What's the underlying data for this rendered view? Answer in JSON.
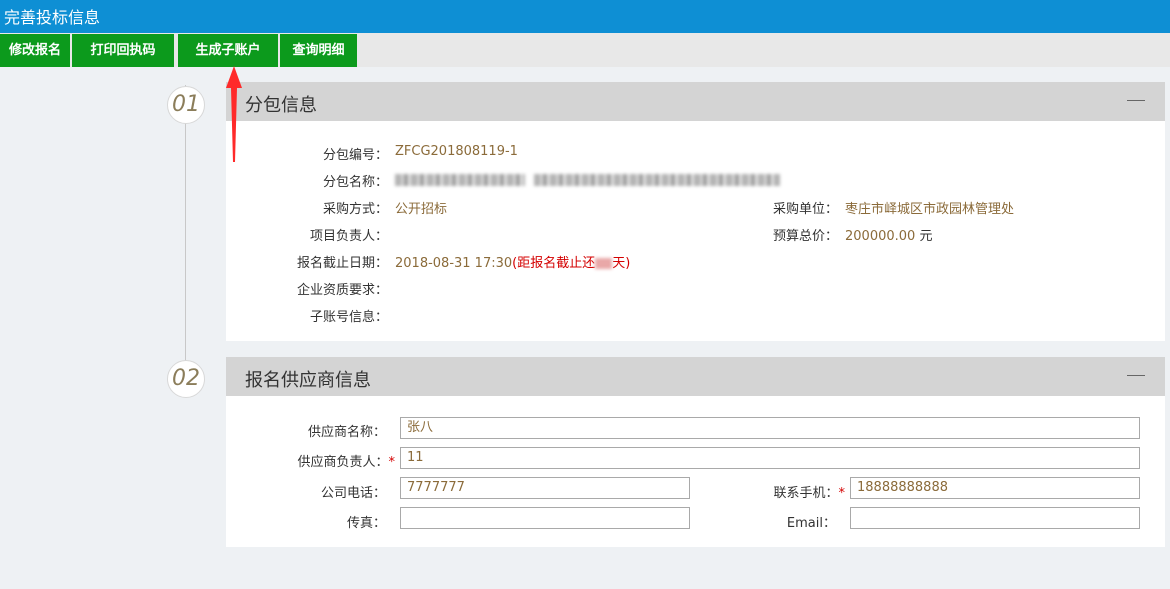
{
  "window": {
    "title": "完善投标信息"
  },
  "toolbar": {
    "modify": "修改报名",
    "print_receipt": "打印回执码",
    "generate_subaccount": "生成子账户",
    "query_details": "查询明细"
  },
  "steps": {
    "step1": "01",
    "step2": "02"
  },
  "package_info": {
    "heading": "分包信息",
    "collapse": "—",
    "number_label": "分包编号：",
    "number_value": "ZFCG201808119-1",
    "name_label": "分包名称：",
    "method_label": "采购方式：",
    "method_value": "公开招标",
    "manager_label": "项目负责人：",
    "deadline_label": "报名截止日期：",
    "deadline_value": "2018-08-31 17:30",
    "deadline_remaining_prefix": "(距报名截止还",
    "deadline_remaining_suffix": "天)",
    "qualification_label": "企业资质要求：",
    "subaccount_label": "子账号信息：",
    "buyer_label": "采购单位：",
    "buyer_value": "枣庄市峄城区市政园林管理处",
    "budget_label": "预算总价：",
    "budget_value": "200000.00",
    "budget_unit": "元"
  },
  "supplier_info": {
    "heading": "报名供应商信息",
    "collapse": "—",
    "name_label": "供应商名称：",
    "name_value": "张八",
    "contact_label": "供应商负责人：",
    "contact_value": "11",
    "phone_label": "公司电话：",
    "phone_value": "7777777",
    "mobile_label": "联系手机：",
    "mobile_value": "18888888888",
    "fax_label": "传真：",
    "fax_value": "",
    "email_label": "Email：",
    "email_value": "",
    "required_mark": "*"
  },
  "colors": {
    "titlebar": "#0e8fd4",
    "toolbar_button": "#0c9a1c",
    "accent_red": "#d40000",
    "value_text": "#8b6b3a"
  }
}
